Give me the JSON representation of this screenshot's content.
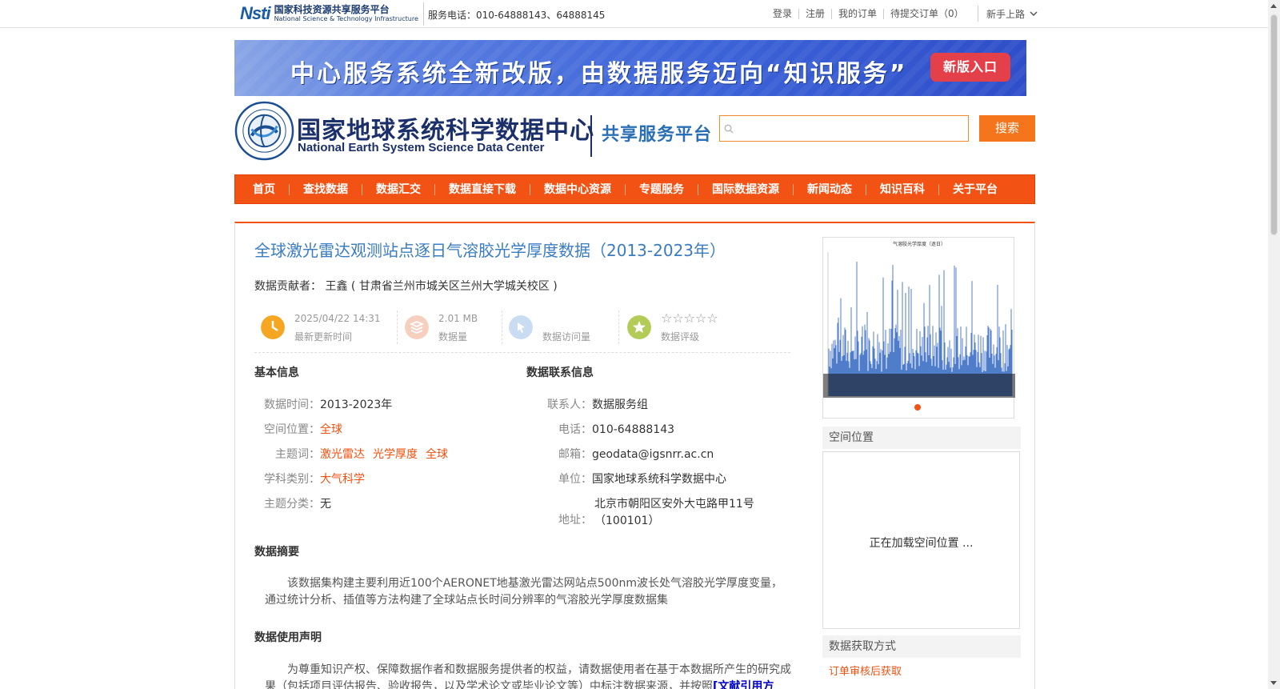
{
  "topbar": {
    "logo_mark": "Nsti",
    "logo_cn": "国家科技资源共享服务平台",
    "logo_en": "National Science & Technology Infrastructure",
    "phone": "服务电话：010-64888143、64888145",
    "links": [
      "登录",
      "注册",
      "我的订单",
      "待提交订单（0）"
    ],
    "guide": "新手上路"
  },
  "banner": {
    "text": "中心服务系统全新改版，由数据服务迈向“知识服务”",
    "button": "新版入口"
  },
  "header": {
    "center_cn": "国家地球系统科学数据中心",
    "center_en": "National Earth System Science Data Center",
    "platform": "共享服务平台",
    "search_button": "搜索",
    "search_value": ""
  },
  "nav": [
    "首页",
    "查找数据",
    "数据汇交",
    "数据直接下载",
    "数据中心资源",
    "专题服务",
    "国际数据资源",
    "新闻动态",
    "知识百科",
    "关于平台"
  ],
  "dataset": {
    "title": "全球激光雷达观测站点逐日气溶胶光学厚度数据（2013-2023年）",
    "contributor_label": "数据贡献者：",
    "contributor": "王鑫 ( 甘肃省兰州市城关区兰州大学城关校区 )",
    "stats": {
      "updated_value": "2025/04/22 14:31",
      "updated_label": "最新更新时间",
      "size_value": "2.01 MB",
      "size_label": "数据量",
      "visits_value": "",
      "visits_label": "数据访问量",
      "rating_stars": "☆☆☆☆☆",
      "rating_label": "数据评级"
    },
    "basic": {
      "heading": "基本信息",
      "time_k": "数据时间：",
      "time_v": "2013-2023年",
      "space_k": "空间位置：",
      "space_v": "全球",
      "kw_k": "主题词：",
      "keywords": [
        "激光雷达",
        "光学厚度",
        "全球"
      ],
      "subject_k": "学科类别：",
      "subject_v": "大气科学",
      "category_k": "主题分类：",
      "category_v": "无"
    },
    "contact": {
      "heading": "数据联系信息",
      "person_k": "联系人：",
      "person_v": "数据服务组",
      "tel_k": "电话：",
      "tel_v": "010-64888143",
      "mail_k": "邮箱：",
      "mail_v": "geodata@igsnrr.ac.cn",
      "unit_k": "单位：",
      "unit_v": "国家地球系统科学数据中心",
      "addr_k": "地址：",
      "addr_v1": "北京市朝阳区安外大屯路甲11号",
      "addr_v2": "（100101）"
    },
    "abstract": {
      "heading": "数据摘要",
      "text": "该数据集构建主要利用近100个AERONET地基激光雷达网站点500nm波长处气溶胶光学厚度变量，通过统计分析、插值等方法构建了全球站点长时间分辨率的气溶胶光学厚度数据集"
    },
    "usage": {
      "heading": "数据使用声明",
      "text": "为尊重知识产权、保障数据作者和数据服务提供者的权益，请数据使用者在基于本数据所产生的研究成果（包括项目评估报告、验收报告，以及学术论文或毕业论文等）中标注数据来源，并按照",
      "link": "[文献引用方"
    }
  },
  "sidebar": {
    "thumb_title": "气溶胶光学厚度（逐日）",
    "spatial_heading": "空间位置",
    "spatial_loading": "正在加载空间位置 ...",
    "access_heading": "数据获取方式",
    "access_value": "订单审核后获取"
  },
  "colors": {
    "accent_orange": "#f25315",
    "title_blue": "#3a7cc1",
    "link_orange": "#f0500f"
  }
}
